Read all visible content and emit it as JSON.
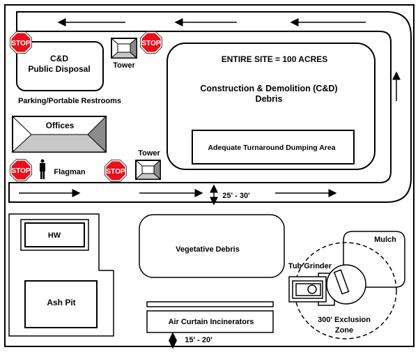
{
  "labels": {
    "cd_public_1": "C&D",
    "cd_public_2": "Public Disposal",
    "tower_top": "Tower",
    "tower_bottom": "Tower",
    "parking": "Parking/Portable Restrooms",
    "offices": "Offices",
    "flagman": "Flagman",
    "entire_site": "ENTIRE SITE = 100 ACRES",
    "cd_debris_1": "Construction & Demolition (C&D)",
    "cd_debris_2": "Debris",
    "turnaround": "Adequate Turnaround Dumping Area",
    "road_width": "25' - 30'",
    "hw": "HW",
    "ash_pit": "Ash Pit",
    "vegetative": "Vegetative Debris",
    "air_curtain": "Air Curtain Incinerators",
    "gap_width": "15' - 20'",
    "mulch": "Mulch",
    "tub_grinder": "Tub Grinder",
    "exclusion_1": "300' Exclusion",
    "exclusion_2": "Zone",
    "stop": "STOP"
  },
  "colors": {
    "stop": "#e8101a",
    "roof_light": "#c8c8c8",
    "roof_dark": "#8c8c8c"
  }
}
